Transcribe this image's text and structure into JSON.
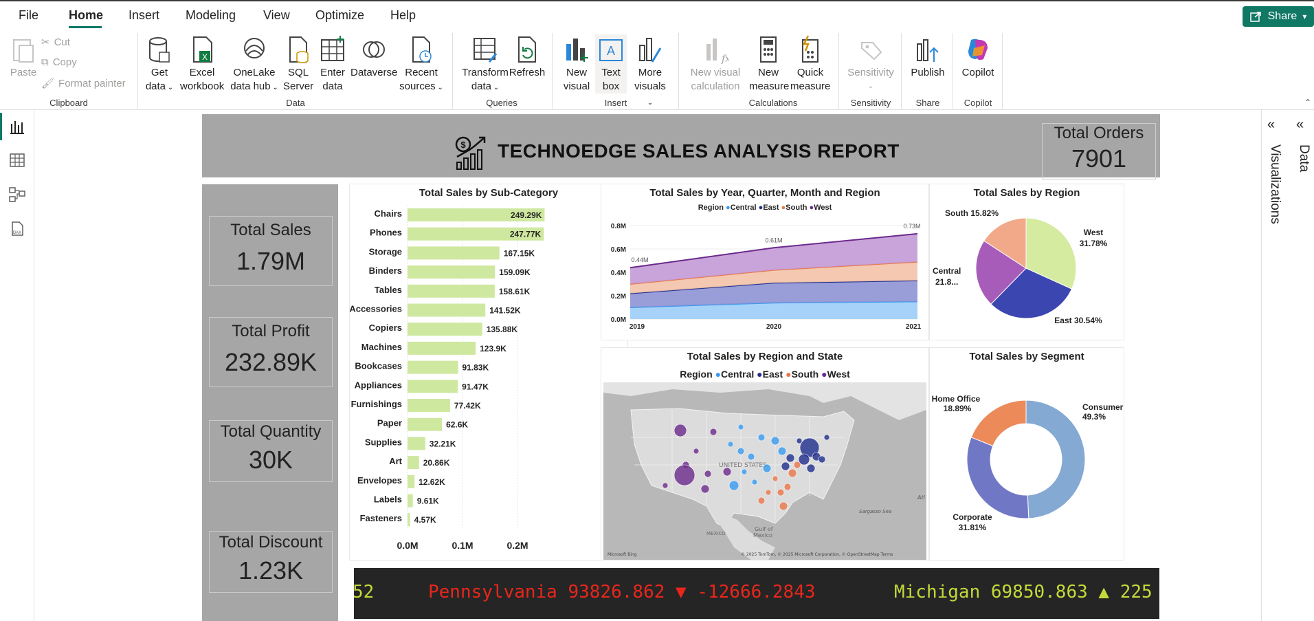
{
  "menu": {
    "file": "File",
    "home": "Home",
    "insert": "Insert",
    "modeling": "Modeling",
    "view": "View",
    "optimize": "Optimize",
    "help": "Help",
    "share": "Share"
  },
  "ribbon": {
    "paste": "Paste",
    "cut": "Cut",
    "copy": "Copy",
    "format_painter": "Format painter",
    "get_data_1": "Get",
    "get_data_2": "data",
    "excel_1": "Excel",
    "excel_2": "workbook",
    "onelake_1": "OneLake",
    "onelake_2": "data hub",
    "sql_1": "SQL",
    "sql_2": "Server",
    "enter_1": "Enter",
    "enter_2": "data",
    "dataverse": "Dataverse",
    "recent_1": "Recent",
    "recent_2": "sources",
    "transform_1": "Transform",
    "transform_2": "data",
    "refresh": "Refresh",
    "new_visual_1": "New",
    "new_visual_2": "visual",
    "textbox_1": "Text",
    "textbox_2": "box",
    "more_1": "More",
    "more_2": "visuals",
    "nvc_1": "New visual",
    "nvc_2": "calculation",
    "nm_1": "New",
    "nm_2": "measure",
    "qm_1": "Quick",
    "qm_2": "measure",
    "sensitivity": "Sensitivity",
    "publish": "Publish",
    "copilot": "Copilot",
    "groups": {
      "clipboard": "Clipboard",
      "data": "Data",
      "queries": "Queries",
      "insert": "Insert",
      "calculations": "Calculations",
      "sensitivity": "Sensitivity",
      "share": "Share",
      "copilot": "Copilot"
    }
  },
  "panes": {
    "visualizations": "Visualizations",
    "data": "Data"
  },
  "report": {
    "title": "TECHNOEDGE SALES ANALYSIS REPORT",
    "orders": {
      "label": "Total Orders",
      "value": "7901"
    },
    "kpis": [
      {
        "label": "Total Sales",
        "value": "1.79M"
      },
      {
        "label": "Total Profit",
        "value": "232.89K"
      },
      {
        "label": "Total Quantity",
        "value": "30K"
      },
      {
        "label": "Total Discount",
        "value": "1.23K"
      }
    ]
  },
  "colors": {
    "central": "#3a9bf0",
    "east": "#1f2e8c",
    "south": "#e8774a",
    "west": "#6b2a8c",
    "bar": "#cfe8a0",
    "band": "#a6a6a6",
    "accent": "#117865"
  },
  "chart_data": [
    {
      "type": "bar",
      "title": "Total Sales by Sub-Category",
      "categories": [
        "Chairs",
        "Phones",
        "Storage",
        "Binders",
        "Tables",
        "Accessories",
        "Copiers",
        "Machines",
        "Bookcases",
        "Appliances",
        "Furnishings",
        "Paper",
        "Supplies",
        "Art",
        "Envelopes",
        "Labels",
        "Fasteners"
      ],
      "values": [
        249290,
        247770,
        167150,
        159090,
        158610,
        141520,
        135880,
        123900,
        91830,
        91470,
        77420,
        62600,
        32210,
        20860,
        12620,
        9610,
        4570
      ],
      "labels": [
        "249.29K",
        "247.77K",
        "167.15K",
        "159.09K",
        "158.61K",
        "141.52K",
        "135.88K",
        "123.9K",
        "91.83K",
        "91.47K",
        "77.42K",
        "62.6K",
        "32.21K",
        "20.86K",
        "12.62K",
        "9.61K",
        "4.57K"
      ],
      "xticks": [
        "0.0M",
        "0.1M",
        "0.2M"
      ],
      "xlim": [
        0,
        0.27
      ]
    },
    {
      "type": "area",
      "title": "Total Sales by Year, Quarter, Month and Region",
      "legend_title": "Region",
      "x": [
        "2019",
        "2020",
        "2021"
      ],
      "yticks": [
        "0.0M",
        "0.2M",
        "0.4M",
        "0.6M",
        "0.8M"
      ],
      "ylim": [
        0,
        0.8
      ],
      "total_labels": [
        "0.44M",
        "0.61M",
        "0.73M"
      ],
      "series": [
        {
          "name": "Central",
          "values": [
            0.1,
            0.14,
            0.15
          ]
        },
        {
          "name": "East",
          "values": [
            0.12,
            0.17,
            0.18
          ]
        },
        {
          "name": "South",
          "values": [
            0.08,
            0.11,
            0.16
          ]
        },
        {
          "name": "West",
          "values": [
            0.14,
            0.19,
            0.24
          ]
        }
      ]
    },
    {
      "type": "pie",
      "title": "Total Sales by Region",
      "slices": [
        {
          "name": "West",
          "label": "West",
          "pct_label": "31.78%",
          "value": 31.78
        },
        {
          "name": "East",
          "label": "East 30.54%",
          "value": 30.54
        },
        {
          "name": "Central",
          "label": "Central",
          "pct_label": "21.8...",
          "value": 21.86
        },
        {
          "name": "South",
          "label": "South 15.82%",
          "value": 15.82
        }
      ]
    },
    {
      "type": "pie",
      "title": "Total Sales by Segment",
      "slices": [
        {
          "name": "Consumer",
          "label": "Consumer",
          "pct_label": "49.3%",
          "value": 49.3
        },
        {
          "name": "Corporate",
          "label": "Corporate",
          "pct_label": "31.81%",
          "value": 31.81
        },
        {
          "name": "Home Office",
          "label": "Home Office",
          "pct_label": "18.89%",
          "value": 18.89
        }
      ]
    }
  ],
  "map": {
    "title": "Total Sales by Region and State",
    "legend_title": "Region",
    "legend": [
      "Central",
      "East",
      "South",
      "West"
    ],
    "labels": {
      "country": "UNITED STATES",
      "gulf": "Gulf of",
      "gulf2": "Mexico",
      "mexico": "MEXICO",
      "sargasso": "Sargasso Sea",
      "atl": "Atl",
      "attribution": "© 2025 TomTom, © 2025 Microsoft Corporation, © OpenStreetMap   Terms",
      "bing": "Microsoft Bing"
    }
  },
  "ticker": {
    "item1": "52",
    "item2": "Pennsylvania 93826.862 ▼ -12666.2843",
    "item3": "Michigan 69850.863 ▲ 225"
  }
}
